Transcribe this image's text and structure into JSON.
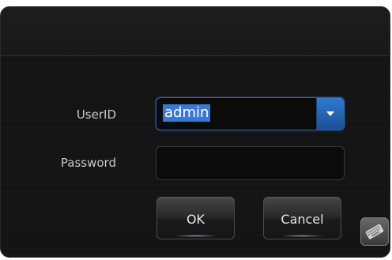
{
  "login": {
    "userid_label": "UserID",
    "userid_value": "admin",
    "password_label": "Password",
    "password_value": "",
    "ok_label": "OK",
    "cancel_label": "Cancel"
  },
  "icons": {
    "dropdown": "chevron-down-icon",
    "keyboard": "keyboard-icon"
  },
  "colors": {
    "accent": "#2f7ad1",
    "selection": "#3a78d6",
    "background": "#141414"
  }
}
